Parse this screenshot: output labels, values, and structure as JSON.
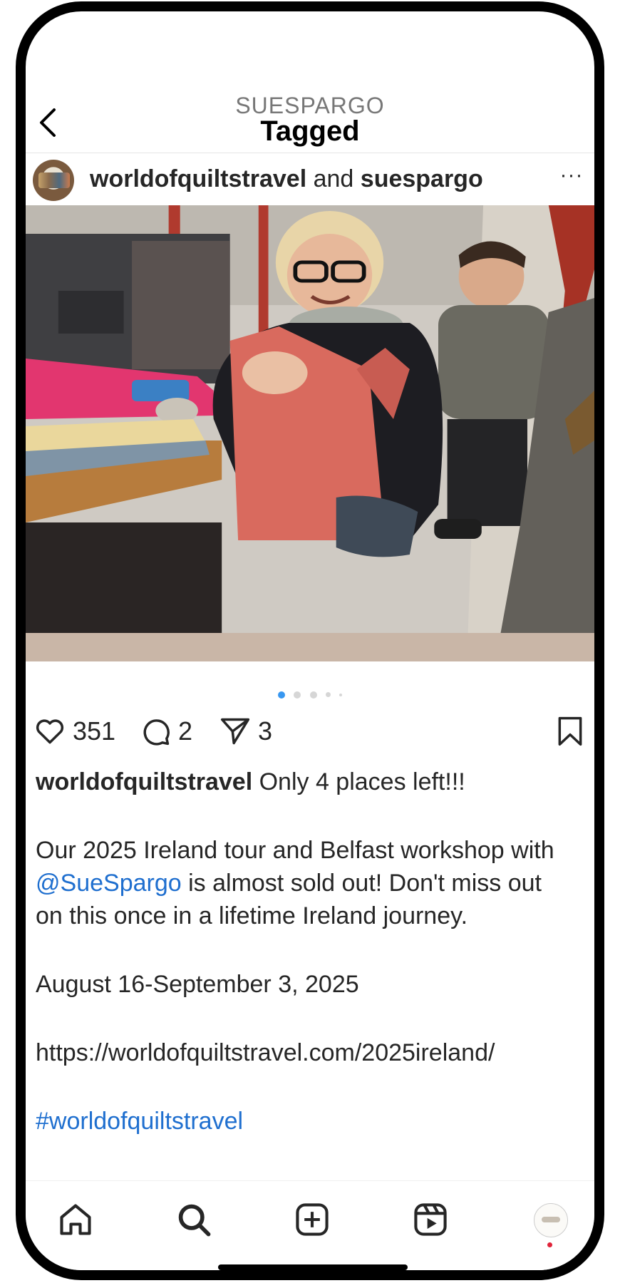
{
  "header": {
    "back_icon": "chevron-left-icon",
    "subtitle": "SUESPARGO",
    "title": "Tagged"
  },
  "post": {
    "author": "worldofquiltstravel",
    "connector": "and",
    "collaborator": "suespargo",
    "more_icon": "more-horizontal-icon",
    "more_label": "···",
    "carousel": {
      "count": 5,
      "active": 0
    },
    "likes": "351",
    "comments": "2",
    "shares": "3",
    "caption": {
      "username": "worldofquiltstravel",
      "headline": " Only 4 places left!!!",
      "para1_part1": "Our 2025 Ireland tour and Belfast workshop with ",
      "mention": "@SueSpargo",
      "para1_part2": " is almost sold out!  Don't miss out on this once in a lifetime Ireland journey.",
      "dates": "August 16-September 3, 2025",
      "link": "https://worldofquiltstravel.com/2025ireland/",
      "hashtag": "#worldofquiltstravel"
    }
  },
  "tabbar": {
    "items": [
      {
        "icon": "home-icon"
      },
      {
        "icon": "search-icon"
      },
      {
        "icon": "create-plus-icon"
      },
      {
        "icon": "reels-icon"
      },
      {
        "icon": "profile-avatar-icon"
      }
    ]
  },
  "colors": {
    "accent": "#1f6fcf",
    "active_dot": "#3897f0",
    "notification": "#e0243a"
  }
}
